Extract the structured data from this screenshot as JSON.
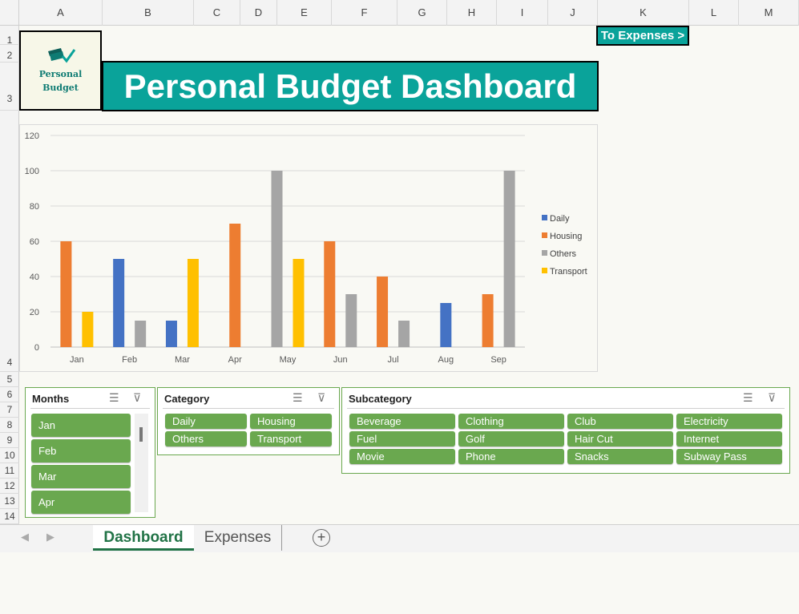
{
  "columns": [
    "A",
    "B",
    "C",
    "D",
    "E",
    "F",
    "G",
    "H",
    "I",
    "J",
    "K",
    "L",
    "M"
  ],
  "rows": [
    "1",
    "2",
    "3",
    "4",
    "5",
    "6",
    "7",
    "8",
    "9",
    "10",
    "11",
    "12",
    "13",
    "14"
  ],
  "logo": {
    "line1": "Personal",
    "line2": "Budget",
    "icon": "money-check-icon"
  },
  "title": "Personal Budget Dashboard",
  "to_expenses_button": "To Expenses >",
  "chart_data": {
    "type": "bar",
    "categories": [
      "Jan",
      "Feb",
      "Mar",
      "Apr",
      "May",
      "Jun",
      "Jul",
      "Aug",
      "Sep"
    ],
    "series": [
      {
        "name": "Daily",
        "color": "#4472c4",
        "values": [
          null,
          50,
          15,
          null,
          null,
          null,
          null,
          25,
          null
        ]
      },
      {
        "name": "Housing",
        "color": "#ed7d31",
        "values": [
          60,
          null,
          null,
          70,
          null,
          60,
          40,
          null,
          30
        ]
      },
      {
        "name": "Others",
        "color": "#a5a5a5",
        "values": [
          null,
          15,
          null,
          null,
          100,
          30,
          15,
          null,
          100
        ]
      },
      {
        "name": "Transport",
        "color": "#ffc000",
        "values": [
          20,
          null,
          50,
          null,
          50,
          null,
          null,
          null,
          null
        ]
      }
    ],
    "yticks": [
      "0",
      "20",
      "40",
      "60",
      "80",
      "100",
      "120"
    ],
    "ylim": [
      0,
      120
    ],
    "grid": true,
    "legend": "right"
  },
  "slicers": {
    "months": {
      "title": "Months",
      "items": [
        "Jan",
        "Feb",
        "Mar",
        "Apr"
      ]
    },
    "category": {
      "title": "Category",
      "items": [
        "Daily",
        "Housing",
        "Others",
        "Transport"
      ]
    },
    "subcategory": {
      "title": "Subcategory",
      "items": [
        "Beverage",
        "Clothing",
        "Club",
        "Electricity",
        "Fuel",
        "Golf",
        "Hair Cut",
        "Internet",
        "Movie",
        "Phone",
        "Snacks",
        "Subway Pass"
      ]
    }
  },
  "icons": {
    "multiselect": "multi-select-icon",
    "clear_filter": "clear-filter-icon"
  },
  "sheet_tabs": {
    "active": "Dashboard",
    "other": "Expenses",
    "add": "+"
  }
}
